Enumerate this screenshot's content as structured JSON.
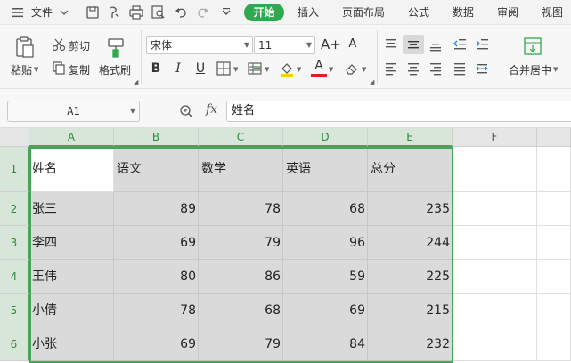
{
  "menu": {
    "file_label": "文件",
    "tabs": [
      {
        "label": "开始",
        "active": true
      },
      {
        "label": "插入",
        "active": false
      },
      {
        "label": "页面布局",
        "active": false
      },
      {
        "label": "公式",
        "active": false
      },
      {
        "label": "数据",
        "active": false
      },
      {
        "label": "审阅",
        "active": false
      },
      {
        "label": "视图",
        "active": false
      }
    ],
    "quick_icons": [
      "save-icon",
      "format-painter-quick-icon",
      "print-icon",
      "print-preview-icon",
      "undo-icon",
      "redo-icon",
      "more-dropdown-icon"
    ]
  },
  "ribbon": {
    "paste_label": "粘贴",
    "cut_label": "剪切",
    "copy_label": "复制",
    "format_painter_label": "格式刷",
    "font_name": "宋体",
    "font_size": "11",
    "increase_font_label": "A+",
    "decrease_font_label": "A-",
    "bold_label": "B",
    "italic_label": "I",
    "underline_label": "U",
    "font_color_label": "A",
    "merge_center_label": "合并居中",
    "accent_color": "#2fa84f",
    "font_color": "#e02020",
    "fill_color": "#f5d000"
  },
  "formula_bar": {
    "cell_ref": "A1",
    "fx_label": "fx",
    "value": "姓名"
  },
  "grid": {
    "columns": [
      "A",
      "B",
      "C",
      "D",
      "E",
      "F"
    ],
    "rows": [
      "1",
      "2",
      "3",
      "4",
      "5",
      "6"
    ],
    "cells": [
      [
        "姓名",
        "语文",
        "数学",
        "英语",
        "总分",
        ""
      ],
      [
        "张三",
        "89",
        "78",
        "68",
        "235",
        ""
      ],
      [
        "李四",
        "69",
        "79",
        "96",
        "244",
        ""
      ],
      [
        "王伟",
        "80",
        "86",
        "59",
        "225",
        ""
      ],
      [
        "小倩",
        "78",
        "68",
        "69",
        "215",
        ""
      ],
      [
        "小张",
        "69",
        "79",
        "84",
        "232",
        ""
      ]
    ],
    "selection_color": "#4aa35a"
  }
}
